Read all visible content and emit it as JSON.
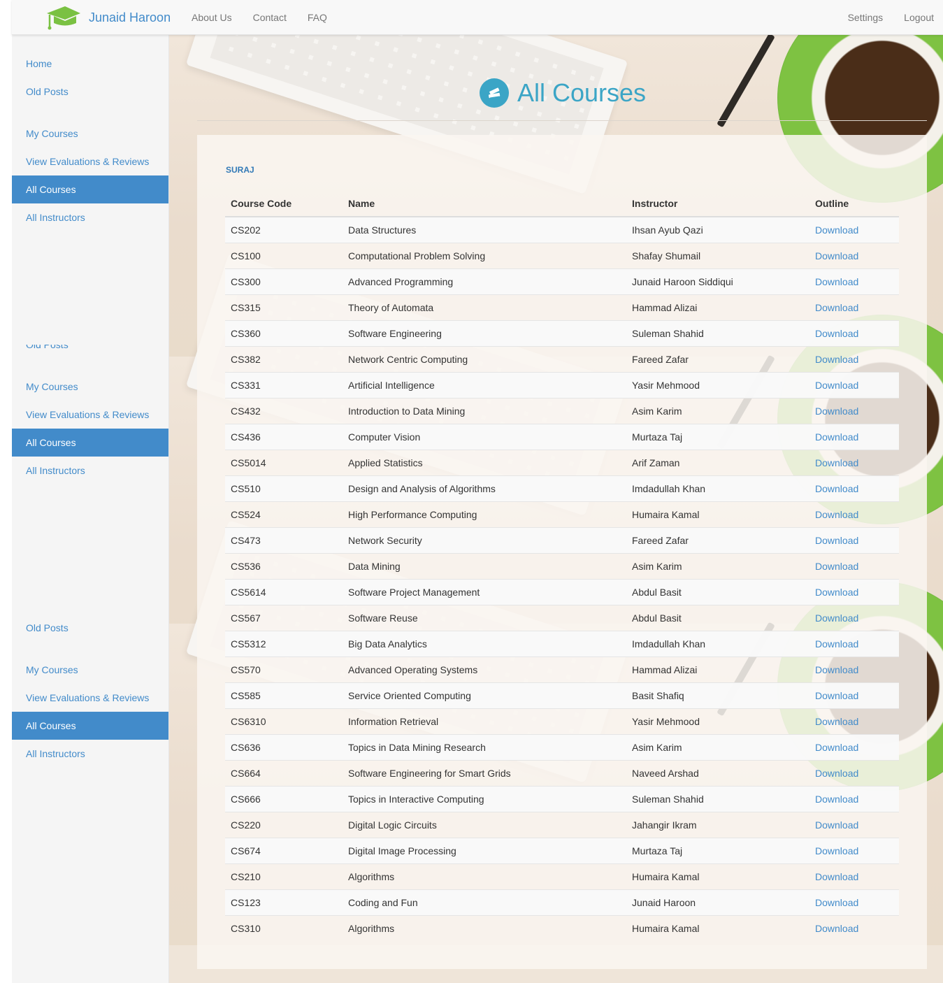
{
  "brand": {
    "name": "Junaid Haroon",
    "icon": "graduation-cap-icon",
    "icon_color": "#7ac142"
  },
  "nav": {
    "left": [
      "About Us",
      "Contact",
      "FAQ"
    ],
    "right": [
      "Settings",
      "Logout"
    ]
  },
  "sidebar": {
    "groups": [
      {
        "items": [
          "Home",
          "Old Posts",
          "My Courses",
          "View Evaluations & Reviews",
          "All Courses",
          "All Instructors"
        ]
      },
      {
        "items": [
          "Old Posts",
          "My Courses",
          "View Evaluations & Reviews",
          "All Courses",
          "All Instructors"
        ]
      },
      {
        "items": [
          "Old Posts",
          "My Courses",
          "View Evaluations & Reviews",
          "All Courses",
          "All Instructors"
        ]
      }
    ],
    "active_label": "All Courses"
  },
  "page": {
    "title": "All Courses",
    "icon": "books-icon"
  },
  "section": {
    "label": "SURAJ"
  },
  "table": {
    "headers": [
      "Course Code",
      "Name",
      "Instructor",
      "Outline"
    ],
    "rows": [
      [
        "CS202",
        "Data Structures",
        "Ihsan Ayub Qazi",
        "Download"
      ],
      [
        "CS100",
        "Computational Problem Solving",
        "Shafay Shumail",
        "Download"
      ],
      [
        "CS300",
        "Advanced Programming",
        "Junaid Haroon Siddiqui",
        "Download"
      ],
      [
        "CS315",
        "Theory of Automata",
        "Hammad Alizai",
        "Download"
      ],
      [
        "CS360",
        "Software Engineering",
        "Suleman Shahid",
        "Download"
      ],
      [
        "CS382",
        "Network Centric Computing",
        "Fareed Zafar",
        "Download"
      ],
      [
        "CS331",
        "Artificial Intelligence",
        "Yasir Mehmood",
        "Download"
      ],
      [
        "CS432",
        "Introduction to Data Mining",
        "Asim Karim",
        "Download"
      ],
      [
        "CS436",
        "Computer Vision",
        "Murtaza Taj",
        "Download"
      ],
      [
        "CS5014",
        "Applied Statistics",
        "Arif Zaman",
        "Download"
      ],
      [
        "CS510",
        "Design and Analysis of Algorithms",
        "Imdadullah Khan",
        "Download"
      ],
      [
        "CS524",
        "High Performance Computing",
        "Humaira Kamal",
        "Download"
      ],
      [
        "CS473",
        "Network Security",
        "Fareed Zafar",
        "Download"
      ],
      [
        "CS536",
        "Data Mining",
        "Asim Karim",
        "Download"
      ],
      [
        "CS5614",
        "Software Project Management",
        "Abdul Basit",
        "Download"
      ],
      [
        "CS567",
        "Software Reuse",
        "Abdul Basit",
        "Download"
      ],
      [
        "CS5312",
        "Big Data Analytics",
        "Imdadullah Khan",
        "Download"
      ],
      [
        "CS570",
        "Advanced Operating Systems",
        "Hammad Alizai",
        "Download"
      ],
      [
        "CS585",
        "Service Oriented Computing",
        "Basit Shafiq",
        "Download"
      ],
      [
        "CS6310",
        "Information Retrieval",
        "Yasir Mehmood",
        "Download"
      ],
      [
        "CS636",
        "Topics in Data Mining Research",
        "Asim Karim",
        "Download"
      ],
      [
        "CS664",
        "Software Engineering for Smart Grids",
        "Naveed Arshad",
        "Download"
      ],
      [
        "CS666",
        "Topics in Interactive Computing",
        "Suleman Shahid",
        "Download"
      ],
      [
        "CS220",
        "Digital Logic Circuits",
        "Jahangir Ikram",
        "Download"
      ],
      [
        "CS674",
        "Digital Image Processing",
        "Murtaza Taj",
        "Download"
      ],
      [
        "CS210",
        "Algorithms",
        "Humaira Kamal",
        "Download"
      ],
      [
        "CS123",
        "Coding and Fun",
        "Junaid Haroon",
        "Download"
      ],
      [
        "CS310",
        "Algorithms",
        "Humaira Kamal",
        "Download"
      ]
    ]
  },
  "colors": {
    "accent": "#428bca",
    "heading": "#3ba5c6"
  }
}
